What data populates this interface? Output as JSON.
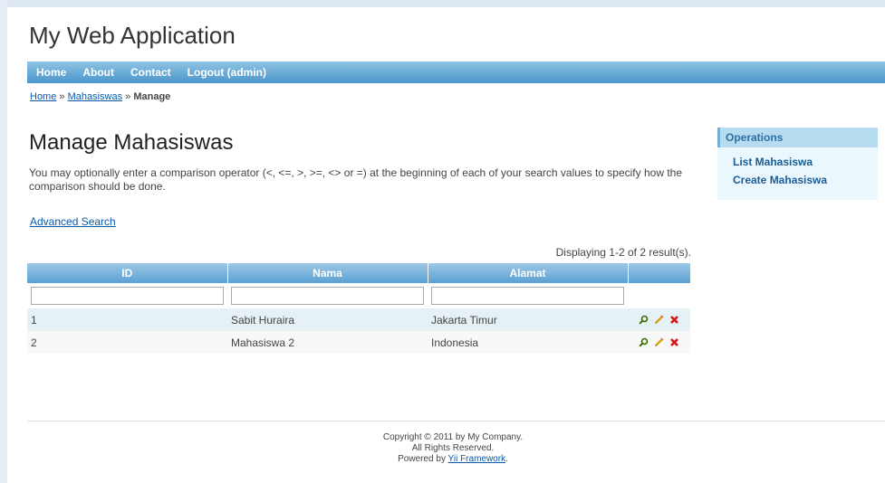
{
  "header": {
    "title": "My Web Application"
  },
  "mainmenu": {
    "items": [
      {
        "label": "Home"
      },
      {
        "label": "About"
      },
      {
        "label": "Contact"
      },
      {
        "label": "Logout (admin)"
      }
    ]
  },
  "breadcrumb": {
    "home": "Home",
    "sep1": " » ",
    "section": "Mahasiswas",
    "sep2": " » ",
    "current": "Manage"
  },
  "main": {
    "title": "Manage Mahasiswas",
    "hint": "You may optionally enter a comparison operator (<, <=, >, >=, <> or =) at the beginning of each of your search values to specify how the comparison should be done.",
    "advanced_search": "Advanced Search",
    "summary": "Displaying 1-2 of 2 result(s).",
    "columns": [
      "ID",
      "Nama",
      "Alamat",
      ""
    ],
    "filters": {
      "id": "",
      "nama": "",
      "alamat": ""
    },
    "rows": [
      {
        "id": "1",
        "nama": "Sabit Huraira",
        "alamat": "Jakarta Timur"
      },
      {
        "id": "2",
        "nama": "Mahasiswa 2",
        "alamat": "Indonesia"
      }
    ]
  },
  "sidebar": {
    "title": "Operations",
    "items": [
      {
        "label": "List Mahasiswa"
      },
      {
        "label": "Create Mahasiswa"
      }
    ]
  },
  "footer": {
    "line1": "Copyright © 2011 by My Company.",
    "line2": "All Rights Reserved.",
    "powered_prefix": "Powered by ",
    "powered_link": "Yii Framework",
    "powered_suffix": "."
  },
  "icons": {
    "view": "magnifier-icon",
    "edit": "pencil-icon",
    "delete": "delete-icon"
  },
  "colors": {
    "menu_bar": "#5aa0d2",
    "link": "#0a59a8",
    "sidebar_bg": "#eaf8fe",
    "row_odd": "#e5f1f4"
  }
}
